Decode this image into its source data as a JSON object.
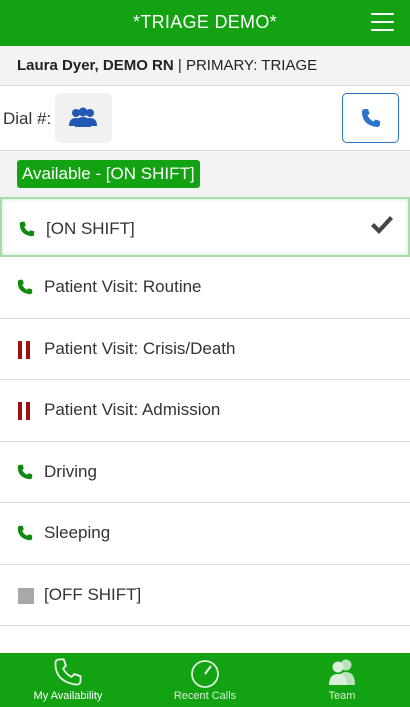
{
  "header": {
    "title": "*TRIAGE DEMO*",
    "menu_icon": "hamburger-menu-icon"
  },
  "user": {
    "name": "Laura Dyer, DEMO RN",
    "separator": "|",
    "role": "PRIMARY: TRIAGE"
  },
  "dial": {
    "label": "Dial #:",
    "group_icon": "group-icon",
    "call_icon": "phone-icon"
  },
  "status": {
    "badge": "Available - [ON SHIFT]"
  },
  "statuses": [
    {
      "label": "[ON SHIFT]",
      "icon": "phone-icon",
      "selected": true
    },
    {
      "label": "Patient Visit: Routine",
      "icon": "phone-icon"
    },
    {
      "label": "Patient Visit: Crisis/Death",
      "icon": "pause-icon"
    },
    {
      "label": "Patient Visit: Admission",
      "icon": "pause-icon"
    },
    {
      "label": "Driving",
      "icon": "phone-icon"
    },
    {
      "label": "Sleeping",
      "icon": "phone-icon"
    },
    {
      "label": "[OFF SHIFT]",
      "icon": "stop-icon"
    }
  ],
  "tabs": [
    {
      "label": "My Availability",
      "icon": "phone-icon",
      "active": true
    },
    {
      "label": "Recent Calls",
      "icon": "timer-icon"
    },
    {
      "label": "Team",
      "icon": "team-icon"
    }
  ],
  "colors": {
    "brand_green": "#13a212",
    "phone_green": "#0e8a0e",
    "busy_red": "#a01010",
    "accent_blue": "#2a74c9",
    "off_gray": "#a8a8a8"
  }
}
